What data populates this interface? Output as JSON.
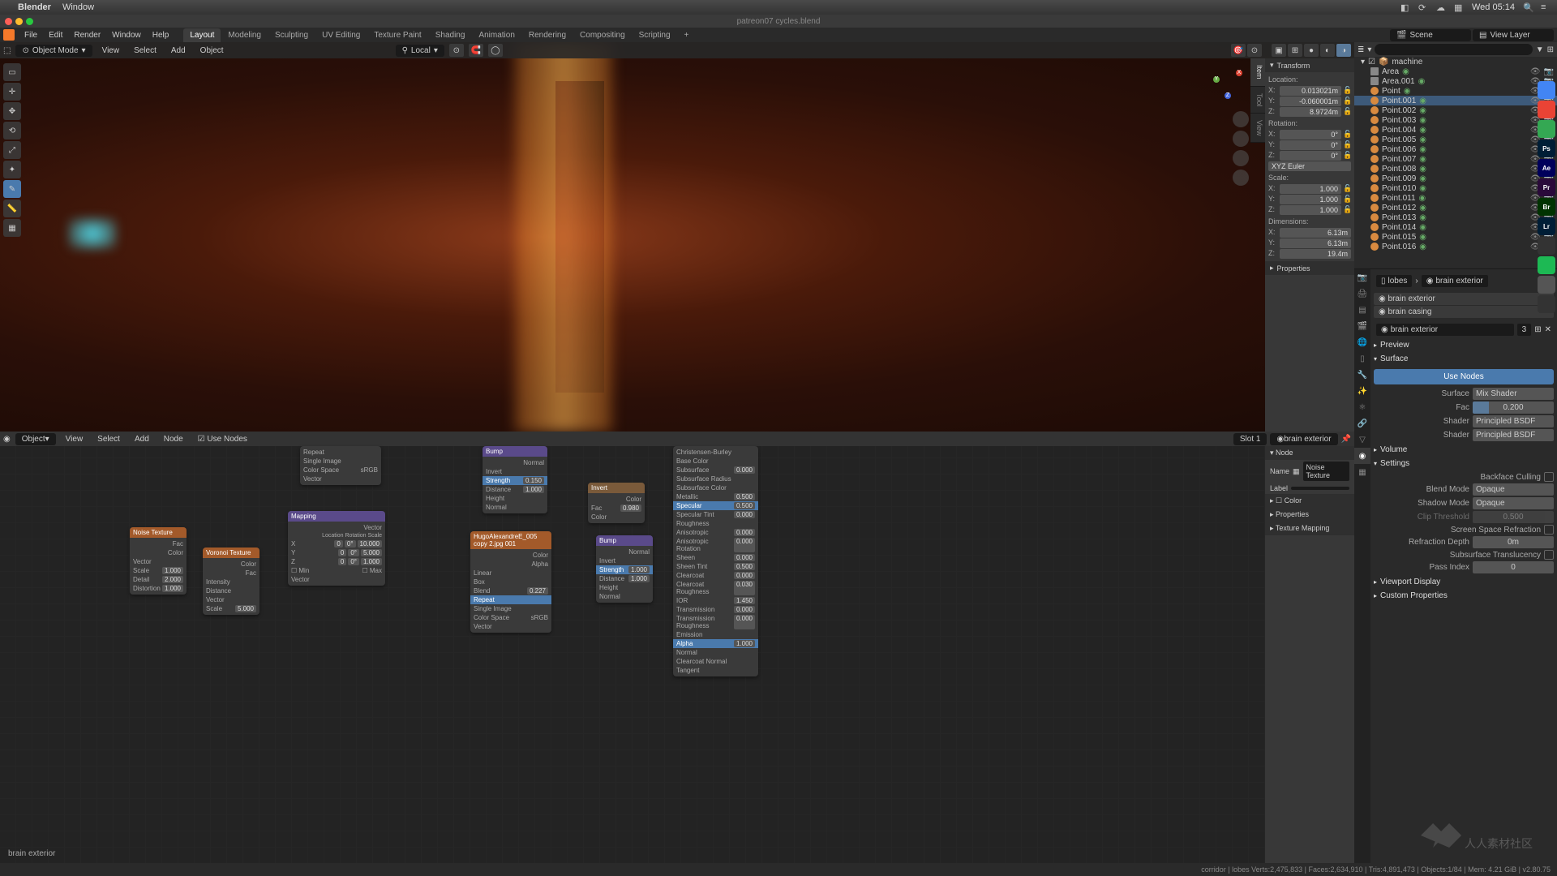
{
  "mac": {
    "app": "Blender",
    "menu": "Window",
    "time": "Wed 05:14"
  },
  "title": "patreon07 cycles.blend",
  "file_menu": [
    "File",
    "Edit",
    "Render",
    "Window",
    "Help"
  ],
  "workspaces": [
    "Layout",
    "Modeling",
    "Sculpting",
    "UV Editing",
    "Texture Paint",
    "Shading",
    "Animation",
    "Rendering",
    "Compositing",
    "Scripting"
  ],
  "active_workspace": "Layout",
  "scene_field": {
    "label": "Scene",
    "value": "Scene"
  },
  "layer_field": {
    "label": "View Layer",
    "value": "View Layer"
  },
  "viewport": {
    "mode": "Object Mode",
    "menus": [
      "View",
      "Select",
      "Add",
      "Object"
    ],
    "orientation": "Local"
  },
  "transform": {
    "header": "Transform",
    "location_label": "Location:",
    "loc": {
      "x": "0.013021m",
      "y": "-0.060001m",
      "z": "8.9724m"
    },
    "rotation_label": "Rotation:",
    "rot": {
      "x": "0°",
      "y": "0°",
      "z": "0°"
    },
    "rot_mode": "XYZ Euler",
    "scale_label": "Scale:",
    "scale": {
      "x": "1.000",
      "y": "1.000",
      "z": "1.000"
    },
    "dim_label": "Dimensions:",
    "dim": {
      "x": "6.13m",
      "y": "6.13m",
      "z": "19.4m"
    },
    "properties_label": "Properties"
  },
  "outliner": {
    "collection": "machine",
    "items": [
      {
        "name": "Area",
        "icon": "area"
      },
      {
        "name": "Area.001",
        "icon": "area"
      },
      {
        "name": "Point",
        "icon": "light"
      },
      {
        "name": "Point.001",
        "icon": "light",
        "selected": true
      },
      {
        "name": "Point.002",
        "icon": "light"
      },
      {
        "name": "Point.003",
        "icon": "light"
      },
      {
        "name": "Point.004",
        "icon": "light"
      },
      {
        "name": "Point.005",
        "icon": "light"
      },
      {
        "name": "Point.006",
        "icon": "light"
      },
      {
        "name": "Point.007",
        "icon": "light"
      },
      {
        "name": "Point.008",
        "icon": "light"
      },
      {
        "name": "Point.009",
        "icon": "light"
      },
      {
        "name": "Point.010",
        "icon": "light"
      },
      {
        "name": "Point.011",
        "icon": "light"
      },
      {
        "name": "Point.012",
        "icon": "light"
      },
      {
        "name": "Point.013",
        "icon": "light"
      },
      {
        "name": "Point.014",
        "icon": "light"
      },
      {
        "name": "Point.015",
        "icon": "light"
      },
      {
        "name": "Point.016",
        "icon": "light"
      }
    ]
  },
  "props": {
    "breadcrumb": {
      "obj": "lobes",
      "mat": "brain exterior"
    },
    "slots": [
      "brain exterior",
      "brain casing"
    ],
    "mat_name": "brain exterior",
    "mat_users": "3",
    "preview": "Preview",
    "surface_header": "Surface",
    "use_nodes": "Use Nodes",
    "surface_label": "Surface",
    "surface_value": "Mix Shader",
    "fac_label": "Fac",
    "fac_value": "0.200",
    "shader1_label": "Shader",
    "shader1_value": "Principled BSDF",
    "shader2_label": "Shader",
    "shader2_value": "Principled BSDF",
    "volume": "Volume",
    "settings": "Settings",
    "backface": "Backface Culling",
    "blend_label": "Blend Mode",
    "blend_value": "Opaque",
    "shadow_label": "Shadow Mode",
    "shadow_value": "Opaque",
    "clip_label": "Clip Threshold",
    "clip_value": "0.500",
    "ssr": "Screen Space Refraction",
    "refr_label": "Refraction Depth",
    "refr_value": "0m",
    "sst": "Subsurface Translucency",
    "pass_label": "Pass Index",
    "pass_value": "0",
    "viewport_display": "Viewport Display",
    "custom_props": "Custom Properties"
  },
  "node_editor": {
    "mode": "Object",
    "menus": [
      "View",
      "Select",
      "Add",
      "Node"
    ],
    "use_nodes": "Use Nodes",
    "slot": "Slot 1",
    "material": "brain exterior",
    "footer_mat": "brain exterior",
    "sidebar": {
      "node_header": "Node",
      "name_label": "Name",
      "name_value": "Noise Texture",
      "label_label": "Label",
      "label_value": "",
      "color_label": "Color",
      "properties_header": "Properties",
      "texmap_header": "Texture Mapping"
    },
    "nodes": {
      "noise": {
        "title": "Noise Texture",
        "rows": [
          [
            "",
            "Fac"
          ],
          [
            "",
            "Color"
          ],
          [
            "Vector",
            ""
          ],
          [
            "Scale",
            "1.000"
          ],
          [
            "Detail",
            "2.000"
          ],
          [
            "Distortion",
            "1.000"
          ]
        ]
      },
      "voronoi": {
        "title": "Voronoi Texture",
        "rows": [
          [
            "",
            "Color"
          ],
          [
            "",
            "Fac"
          ],
          [
            "Intensity",
            ""
          ],
          [
            "Distance",
            ""
          ],
          [
            "Vector",
            ""
          ],
          [
            "Scale",
            "5.000"
          ]
        ]
      },
      "img1": {
        "title": "",
        "rows": [
          [
            "Repeat",
            ""
          ],
          [
            "Single Image",
            ""
          ],
          [
            "Color Space",
            "sRGB"
          ],
          [
            "Vector",
            ""
          ]
        ]
      },
      "mapping": {
        "title": "Mapping",
        "out": "Vector",
        "cols": [
          "Location",
          "Rotation",
          "Scale"
        ],
        "r": [
          [
            "X",
            "0",
            "0°",
            "10.000"
          ],
          [
            "Y",
            "0",
            "0°",
            "5.000"
          ],
          [
            "Z",
            "0",
            "0°",
            "1.000"
          ]
        ],
        "min": "Min",
        "max": "Max",
        "vec": "Vector"
      },
      "bump1": {
        "title": "Bump",
        "rows": [
          [
            "",
            "Normal"
          ],
          [
            "Invert",
            ""
          ],
          [
            "Strength",
            "0.150"
          ],
          [
            "Distance",
            "1.000"
          ],
          [
            "Height",
            ""
          ],
          [
            "Normal",
            ""
          ]
        ]
      },
      "img2": {
        "title": "HugoAlexandreE_005 copy 2.jpg 001",
        "rows": [
          [
            "",
            "Color"
          ],
          [
            "",
            "Alpha"
          ],
          [
            "Linear",
            ""
          ],
          [
            "Box",
            ""
          ],
          [
            "Blend",
            "0.227"
          ],
          [
            "Repeat",
            ""
          ],
          [
            "Single Image",
            ""
          ],
          [
            "Color Space",
            "sRGB"
          ],
          [
            "Vector",
            ""
          ]
        ]
      },
      "invert": {
        "title": "Invert",
        "rows": [
          [
            "",
            "Color"
          ],
          [
            "Fac",
            "0.980"
          ],
          [
            "Color",
            ""
          ]
        ]
      },
      "bump2": {
        "title": "Bump",
        "rows": [
          [
            "",
            "Normal"
          ],
          [
            "Invert",
            ""
          ],
          [
            "Strength",
            "1.000"
          ],
          [
            "Distance",
            "1.000"
          ],
          [
            "Height",
            ""
          ],
          [
            "Normal",
            ""
          ]
        ]
      },
      "bsdf": {
        "title": "",
        "rows": [
          [
            "Christensen-Burley",
            ""
          ],
          [
            "Base Color",
            ""
          ],
          [
            "Subsurface",
            "0.000"
          ],
          [
            "Subsurface Radius",
            ""
          ],
          [
            "Subsurface Color",
            ""
          ],
          [
            "Metallic",
            "0.500"
          ],
          [
            "Specular",
            "0.500"
          ],
          [
            "Specular Tint",
            "0.000"
          ],
          [
            "Roughness",
            ""
          ],
          [
            "Anisotropic",
            "0.000"
          ],
          [
            "Anisotropic Rotation",
            "0.000"
          ],
          [
            "Sheen",
            "0.000"
          ],
          [
            "Sheen Tint",
            "0.500"
          ],
          [
            "Clearcoat",
            "0.000"
          ],
          [
            "Clearcoat Roughness",
            "0.030"
          ],
          [
            "IOR",
            "1.450"
          ],
          [
            "Transmission",
            "0.000"
          ],
          [
            "Transmission Roughness",
            "0.000"
          ],
          [
            "Emission",
            ""
          ],
          [
            "Alpha",
            "1.000"
          ],
          [
            "Normal",
            ""
          ],
          [
            "Clearcoat Normal",
            ""
          ],
          [
            "Tangent",
            ""
          ]
        ]
      }
    }
  },
  "status": {
    "left": "",
    "right": "corridor | lobes   Verts:2,475,833 | Faces:2,634,910 | Tris:4,891,473 | Objects:1/84 | Mem: 4.21 GiB | v2.80.75"
  },
  "dock_apps": [
    {
      "bg": "#4285f4",
      "t": ""
    },
    {
      "bg": "#ea4335",
      "t": ""
    },
    {
      "bg": "#34a853",
      "t": ""
    },
    {
      "bg": "#001e36",
      "t": "Ps"
    },
    {
      "bg": "#00005b",
      "t": "Ae"
    },
    {
      "bg": "#2a0a3a",
      "t": "Pr"
    },
    {
      "bg": "#013301",
      "t": "Br"
    },
    {
      "bg": "#001e36",
      "t": "Lr"
    },
    {
      "bg": "#333",
      "t": ""
    },
    {
      "bg": "#1db954",
      "t": ""
    },
    {
      "bg": "#555",
      "t": ""
    },
    {
      "bg": "#333",
      "t": ""
    }
  ]
}
